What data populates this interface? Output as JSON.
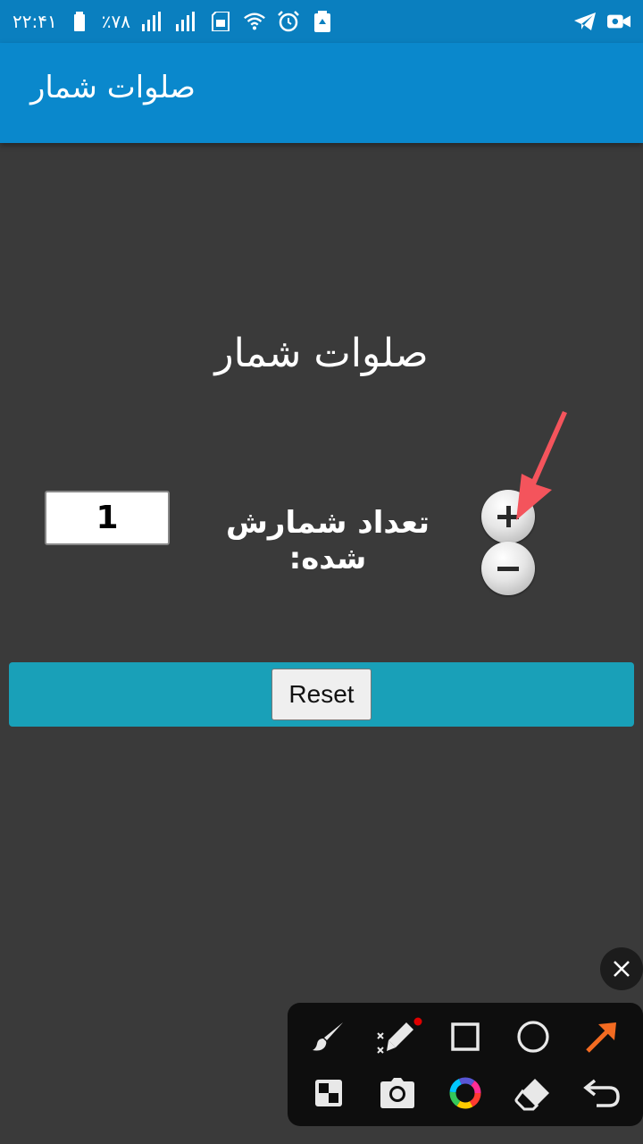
{
  "status_bar": {
    "time": "۲۲:۴۱",
    "battery": "٪۷۸",
    "icons": [
      "battery-icon",
      "signal-icon",
      "signal-icon",
      "sim-icon",
      "wifi-icon",
      "alarm-icon",
      "recycle-icon",
      "telegram-icon",
      "video-camera-icon"
    ]
  },
  "app_bar": {
    "title": "صلوات شمار"
  },
  "main": {
    "heading": "صلوات شمار",
    "counter_value": "1",
    "counter_label": "تعداد شمارش شده:",
    "reset_label": "Reset"
  },
  "colors": {
    "status_bar": "#0a7fbf",
    "app_bar": "#0a88cc",
    "background": "#3a3a3a",
    "reset_bar": "#19a0b8",
    "annotation_arrow": "#f4545c",
    "toolbar": "#0e0e0e"
  },
  "toolbar": {
    "tools": [
      "brush-icon",
      "magic-marker-icon",
      "square-icon",
      "circle-icon",
      "arrow-icon",
      "mosaic-icon",
      "camera-icon",
      "color-wheel-icon",
      "eraser-icon",
      "undo-icon"
    ]
  }
}
